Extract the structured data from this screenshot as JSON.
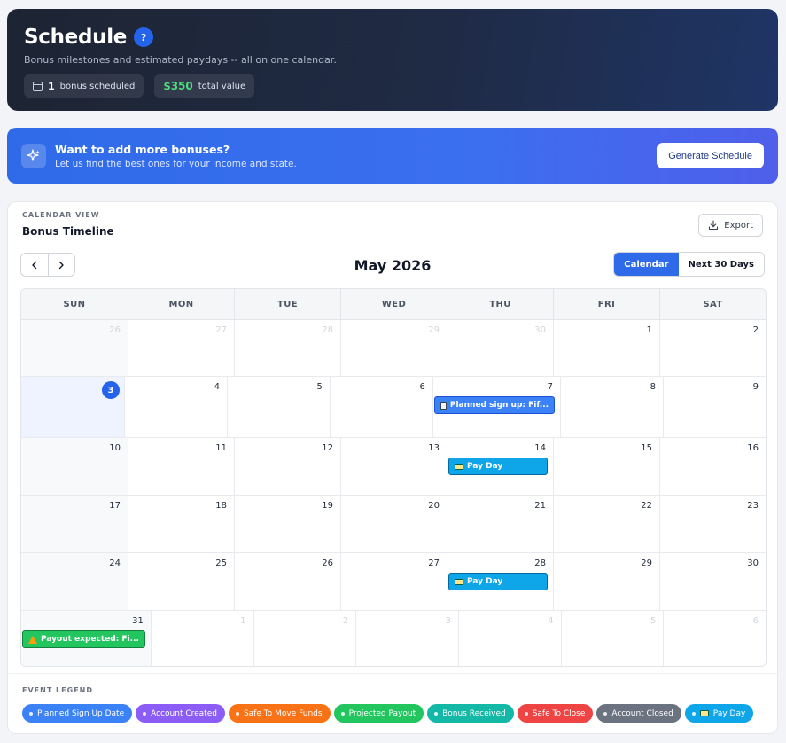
{
  "header": {
    "title": "Schedule",
    "help_label": "?",
    "subtitle": "Bonus milestones and estimated paydays -- all on one calendar.",
    "stats": {
      "bonus_count": "1",
      "bonus_label": "bonus scheduled",
      "total_value": "$350",
      "total_label": "total value"
    }
  },
  "promo": {
    "title": "Want to add more bonuses?",
    "subtitle": "Let us find the best ones for your income and state.",
    "button_label": "Generate Schedule"
  },
  "calendar": {
    "eyebrow": "CALENDAR VIEW",
    "title": "Bonus Timeline",
    "export_label": "Export",
    "prev_label": "‹",
    "next_label": "›",
    "month_label": "May 2026",
    "views": [
      "Calendar",
      "Next 30 Days"
    ],
    "active_view": "Calendar",
    "weekdays": [
      "SUN",
      "MON",
      "TUE",
      "WED",
      "THU",
      "FRI",
      "SAT"
    ],
    "weeks": [
      [
        "26",
        "27",
        "28",
        "29",
        "30",
        "1",
        "2"
      ],
      [
        "3",
        "4",
        "5",
        "6",
        "7",
        "8",
        "9"
      ],
      [
        "10",
        "11",
        "12",
        "13",
        "14",
        "15",
        "16"
      ],
      [
        "17",
        "18",
        "19",
        "20",
        "21",
        "22",
        "23"
      ],
      [
        "24",
        "25",
        "26",
        "27",
        "28",
        "29",
        "30"
      ],
      [
        "31",
        "1",
        "2",
        "3",
        "4",
        "5",
        "6"
      ]
    ],
    "today": "3",
    "events": {
      "planned": "Planned sign up: Fif...",
      "payday_14": "Pay Day",
      "payday_28": "Pay Day",
      "payout": "Payout expected: Fi..."
    }
  },
  "legend": {
    "title": "EVENT LEGEND",
    "items": [
      {
        "label": "Planned Sign Up Date",
        "color": "#3b82f6"
      },
      {
        "label": "Account Created",
        "color": "#8b5cf6"
      },
      {
        "label": "Safe To Move Funds",
        "color": "#f97316"
      },
      {
        "label": "Projected Payout",
        "color": "#22c55e"
      },
      {
        "label": "Bonus Received",
        "color": "#14b8a6"
      },
      {
        "label": "Safe To Close",
        "color": "#ef4444"
      },
      {
        "label": "Account Closed",
        "color": "#6b7280"
      },
      {
        "label": "Pay Day",
        "color": "#0ea5e9"
      }
    ]
  }
}
